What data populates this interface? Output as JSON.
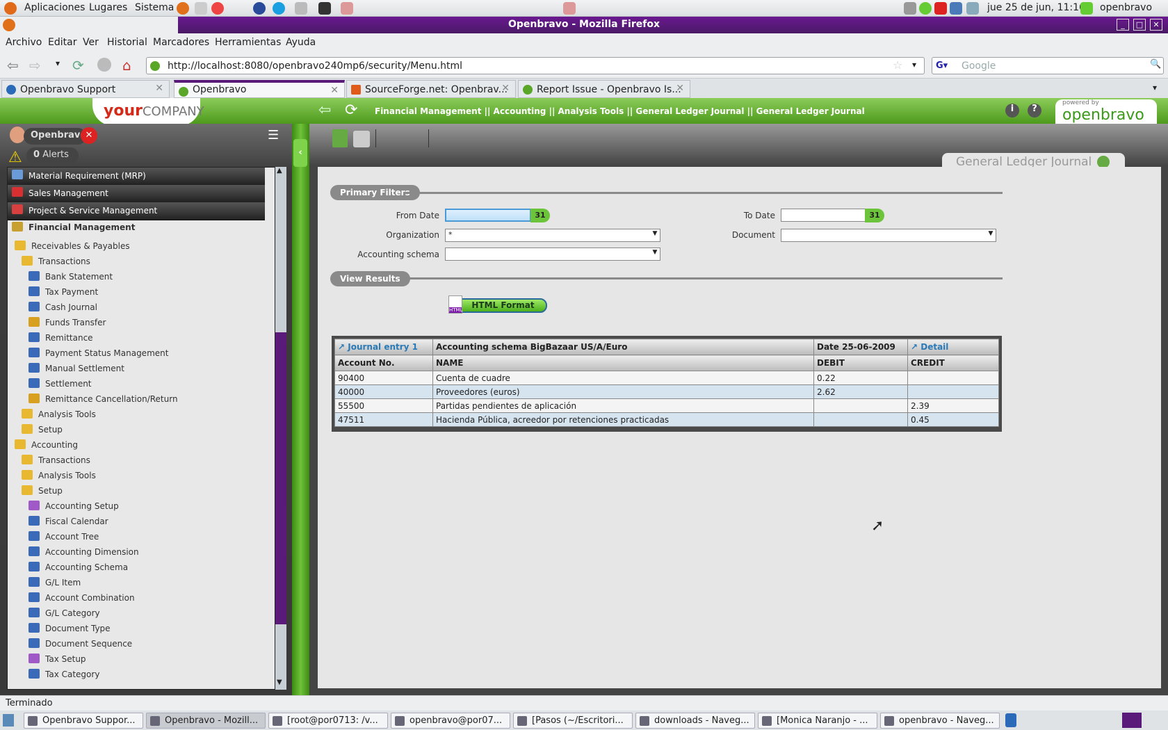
{
  "gnome_panel": {
    "menus": [
      "Aplicaciones",
      "Lugares",
      "Sistema"
    ],
    "clock": "jue 25 de jun, 11:16",
    "user": "openbravo"
  },
  "window": {
    "title": "Openbravo - Mozilla Firefox"
  },
  "menubar": [
    "Archivo",
    "Editar",
    "Ver",
    "Historial",
    "Marcadores",
    "Herramientas",
    "Ayuda"
  ],
  "navbar": {
    "url": "http://localhost:8080/openbravo240mp6/security/Menu.html",
    "search_placeholder": "Google"
  },
  "tabs": [
    {
      "label": "Openbravo Support",
      "active": false
    },
    {
      "label": "Openbravo",
      "active": true
    },
    {
      "label": "SourceForge.net: Openbrav...",
      "active": false
    },
    {
      "label": "Report Issue - Openbravo Is...",
      "active": false
    }
  ],
  "header": {
    "logo_your": "your",
    "logo_company": "COMPANY",
    "breadcrumb": "Financial Management || Accounting || Analysis Tools || General Ledger Journal  ||  General Ledger Journal",
    "powered_by": "powered by",
    "brand": "openbravo"
  },
  "user_panel": {
    "user": "Openbravo",
    "alerts_count": "0",
    "alerts_label": "Alerts"
  },
  "sidebar": [
    {
      "label": "Material Requirement (MRP)",
      "level": 0,
      "style": "dark",
      "icon": "mrp-icon"
    },
    {
      "label": "Sales Management",
      "level": 0,
      "style": "dark",
      "icon": "sales-icon"
    },
    {
      "label": "Project & Service Management",
      "level": 0,
      "style": "dark",
      "icon": "project-icon"
    },
    {
      "label": "Financial Management",
      "level": 0,
      "style": "bold",
      "icon": "coins-icon"
    },
    {
      "label": "Receivables & Payables",
      "level": 1,
      "icon": "folder-icon"
    },
    {
      "label": "Transactions",
      "level": 2,
      "icon": "folder-icon"
    },
    {
      "label": "Bank Statement",
      "level": 3,
      "icon": "window-icon"
    },
    {
      "label": "Tax Payment",
      "level": 3,
      "icon": "window-icon"
    },
    {
      "label": "Cash Journal",
      "level": 3,
      "icon": "window-icon"
    },
    {
      "label": "Funds Transfer",
      "level": 3,
      "icon": "process-icon"
    },
    {
      "label": "Remittance",
      "level": 3,
      "icon": "window-icon"
    },
    {
      "label": "Payment Status Management",
      "level": 3,
      "icon": "window-icon"
    },
    {
      "label": "Manual Settlement",
      "level": 3,
      "icon": "window-icon"
    },
    {
      "label": "Settlement",
      "level": 3,
      "icon": "window-icon"
    },
    {
      "label": "Remittance Cancellation/Return",
      "level": 3,
      "icon": "process-icon"
    },
    {
      "label": "Analysis Tools",
      "level": 2,
      "icon": "folder-icon"
    },
    {
      "label": "Setup",
      "level": 2,
      "icon": "folder-icon"
    },
    {
      "label": "Accounting",
      "level": 1,
      "icon": "folder-icon"
    },
    {
      "label": "Transactions",
      "level": 2,
      "icon": "folder-icon"
    },
    {
      "label": "Analysis Tools",
      "level": 2,
      "icon": "folder-icon"
    },
    {
      "label": "Setup",
      "level": 2,
      "icon": "folder-icon"
    },
    {
      "label": "Accounting Setup",
      "level": 3,
      "icon": "setup-icon"
    },
    {
      "label": "Fiscal Calendar",
      "level": 3,
      "icon": "window-icon"
    },
    {
      "label": "Account Tree",
      "level": 3,
      "icon": "window-icon"
    },
    {
      "label": "Accounting Dimension",
      "level": 3,
      "icon": "window-icon"
    },
    {
      "label": "Accounting Schema",
      "level": 3,
      "icon": "window-icon"
    },
    {
      "label": "G/L Item",
      "level": 3,
      "icon": "window-icon"
    },
    {
      "label": "Account Combination",
      "level": 3,
      "icon": "window-icon"
    },
    {
      "label": "G/L Category",
      "level": 3,
      "icon": "window-icon"
    },
    {
      "label": "Document Type",
      "level": 3,
      "icon": "window-icon"
    },
    {
      "label": "Document Sequence",
      "level": 3,
      "icon": "window-icon"
    },
    {
      "label": "Tax Setup",
      "level": 3,
      "icon": "setup-icon"
    },
    {
      "label": "Tax Category",
      "level": 3,
      "icon": "window-icon"
    }
  ],
  "page": {
    "tab_title": "General Ledger Journal",
    "primary_filters": "Primary Filters",
    "view_results": "View Results",
    "from_date_label": "From Date",
    "from_date": "",
    "to_date_label": "To Date",
    "to_date": "",
    "calendar_label": "31",
    "organization_label": "Organization",
    "organization": "*",
    "document_label": "Document",
    "document": "",
    "accounting_schema_label": "Accounting schema",
    "accounting_schema": "",
    "html_format": "HTML Format",
    "html_icon": "HTML"
  },
  "report": {
    "journal_entry": "Journal entry 1",
    "schema": "Accounting schema BigBazaar US/A/Euro",
    "date": "Date 25-06-2009",
    "detail": "Detail",
    "columns": [
      "Account No.",
      "NAME",
      "DEBIT",
      "CREDIT"
    ],
    "rows": [
      [
        "90400",
        "Cuenta de cuadre",
        "0.22",
        ""
      ],
      [
        "40000",
        "Proveedores (euros)",
        "2.62",
        ""
      ],
      [
        "55500",
        "Partidas pendientes de aplicación",
        "",
        "2.39"
      ],
      [
        "47511",
        "Hacienda Pública, acreedor por retenciones practicadas",
        "",
        "0.45"
      ]
    ]
  },
  "status": "Terminado",
  "taskbar": [
    {
      "label": "Openbravo Suppor...",
      "active": false
    },
    {
      "label": "Openbravo - Mozill...",
      "active": true
    },
    {
      "label": "[root@por0713: /v...",
      "active": false
    },
    {
      "label": "openbravo@por07...",
      "active": false
    },
    {
      "label": "[Pasos (~/Escritori...",
      "active": false
    },
    {
      "label": "downloads - Naveg...",
      "active": false
    },
    {
      "label": "[Monica Naranjo - ...",
      "active": false
    },
    {
      "label": "openbravo - Naveg...",
      "active": false
    }
  ]
}
